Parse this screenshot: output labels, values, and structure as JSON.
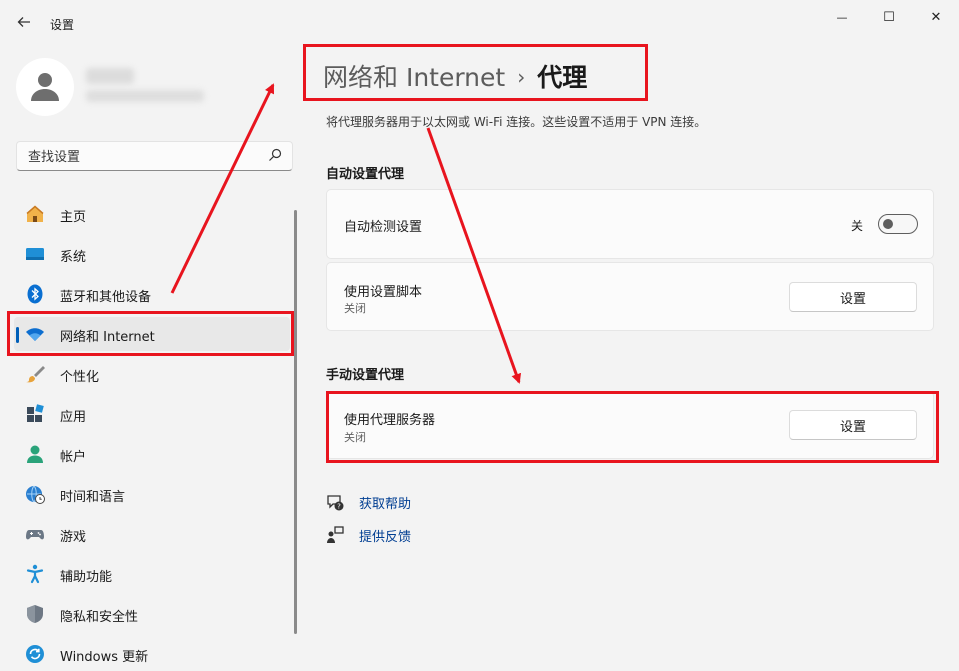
{
  "window": {
    "title": "设置",
    "controls": {
      "minimize": "—",
      "maximize": "☐",
      "close": "✕"
    }
  },
  "search": {
    "placeholder": "查找设置"
  },
  "nav": {
    "items": [
      {
        "label": "主页",
        "icon": "home-icon"
      },
      {
        "label": "系统",
        "icon": "system-icon"
      },
      {
        "label": "蓝牙和其他设备",
        "icon": "bluetooth-icon"
      },
      {
        "label": "网络和 Internet",
        "icon": "wifi-icon",
        "active": true
      },
      {
        "label": "个性化",
        "icon": "brush-icon"
      },
      {
        "label": "应用",
        "icon": "apps-icon"
      },
      {
        "label": "帐户",
        "icon": "account-icon"
      },
      {
        "label": "时间和语言",
        "icon": "globe-clock-icon"
      },
      {
        "label": "游戏",
        "icon": "gamepad-icon"
      },
      {
        "label": "辅助功能",
        "icon": "accessibility-icon"
      },
      {
        "label": "隐私和安全性",
        "icon": "shield-icon"
      },
      {
        "label": "Windows 更新",
        "icon": "update-icon"
      }
    ]
  },
  "main": {
    "breadcrumb": {
      "parent": "网络和 Internet",
      "separator": "›",
      "current": "代理"
    },
    "description": "将代理服务器用于以太网或 Wi-Fi 连接。这些设置不适用于 VPN 连接。",
    "auto_section": {
      "title": "自动设置代理",
      "detect": {
        "label": "自动检测设置",
        "toggle_state": "关"
      },
      "script": {
        "label": "使用设置脚本",
        "status": "关闭",
        "button": "设置"
      }
    },
    "manual_section": {
      "title": "手动设置代理",
      "proxy": {
        "label": "使用代理服务器",
        "status": "关闭",
        "button": "设置"
      }
    },
    "links": {
      "help": "获取帮助",
      "feedback": "提供反馈"
    }
  },
  "colors": {
    "accent": "#005fb8",
    "annotation_red": "#e8141e",
    "link": "#003e92"
  }
}
